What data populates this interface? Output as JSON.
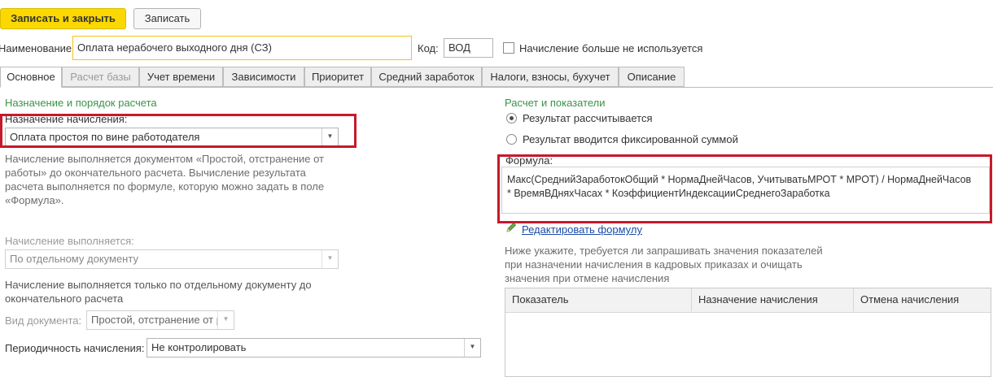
{
  "toolbar": {
    "save_close_label": "Записать и закрыть",
    "save_label": "Записать"
  },
  "header": {
    "name_label": "Наименование:",
    "name_value": "Оплата нерабочего выходного дня (СЗ)",
    "code_label": "Код:",
    "code_value": "ВОД",
    "not_used_label": "Начисление больше не используется"
  },
  "tabs": [
    {
      "label": "Основное"
    },
    {
      "label": "Расчет базы"
    },
    {
      "label": "Учет времени"
    },
    {
      "label": "Зависимости"
    },
    {
      "label": "Приоритет"
    },
    {
      "label": "Средний заработок"
    },
    {
      "label": "Налоги, взносы, бухучет"
    },
    {
      "label": "Описание"
    }
  ],
  "left": {
    "section_title": "Назначение и порядок расчета",
    "purpose_label": "Назначение начисления:",
    "purpose_value": "Оплата простоя по вине работодателя",
    "purpose_hint": "Начисление выполняется документом «Простой, отстранение от работы» до окончательного расчета. Вычисление результата расчета выполняется по формуле, которую можно задать в поле «Формула».",
    "executed_label": "Начисление выполняется:",
    "executed_value": "По отдельному документу",
    "executed_hint": "Начисление выполняется только по отдельному документу до окончательного расчета",
    "doc_type_label": "Вид документа:",
    "doc_type_value": "Простой, отстранение от р",
    "periodicity_label": "Периодичность начисления:",
    "periodicity_value": "Не контролировать"
  },
  "right": {
    "section_title": "Расчет и показатели",
    "radio_calculated": "Результат рассчитывается",
    "radio_fixed": "Результат вводится фиксированной суммой",
    "formula_label": "Формула:",
    "formula_line1": "Макс(СреднийЗаработокОбщий * НормаДнейЧасов, УчитыватьМРОТ * МРОТ) / НормаДнейЧасов",
    "formula_line2": "* ВремяВДняхЧасах * КоэффициентИндексацииСреднегоЗаработка",
    "edit_formula_link": "Редактировать формулу",
    "indicators_hint": "Ниже укажите, требуется ли запрашивать значения показателей при назначении начисления в кадровых приказах и очищать значения при отмене начисления",
    "table_columns": [
      "Показатель",
      "Назначение начисления",
      "Отмена начисления"
    ]
  },
  "colors": {
    "accent_button": "#fbd900",
    "section_title": "#3a9347",
    "highlight_frame": "#c6192b",
    "link": "#1b4aa8"
  },
  "icons": {
    "edit": "pencil-icon",
    "dropdown": "chevron-down-icon"
  }
}
